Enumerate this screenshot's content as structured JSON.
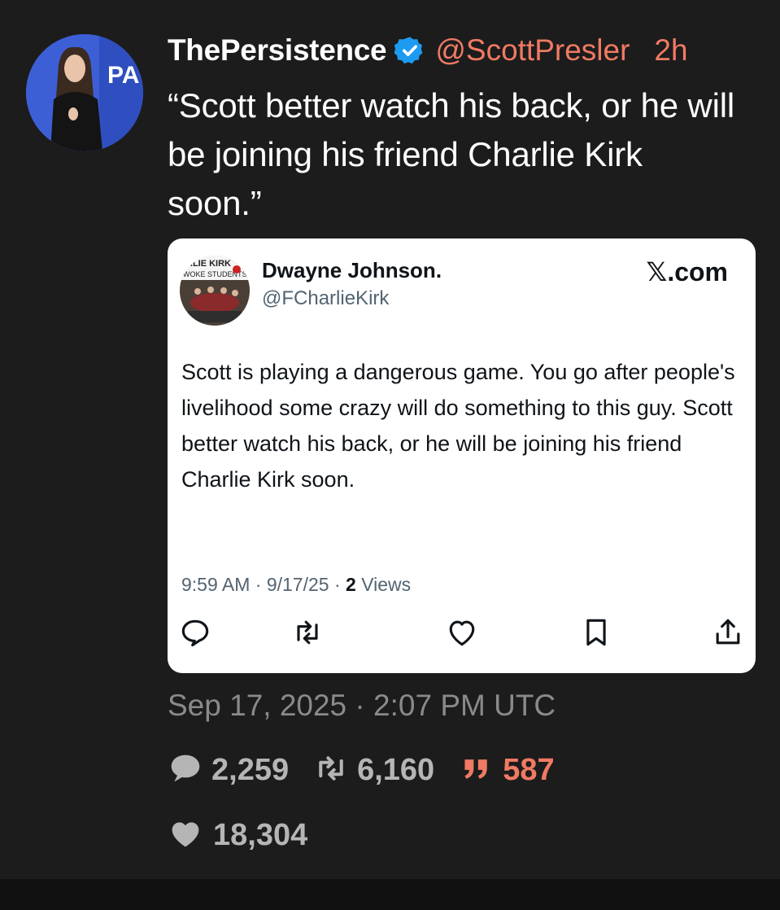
{
  "author": {
    "display_name": "ThePersistence",
    "handle": "@ScottPresler",
    "time_ago": "2h"
  },
  "tweet_text": "“Scott better watch his back, or he will be joining his friend Charlie Kirk soon.”",
  "quoted_post": {
    "display_name": "Dwayne Johnson.",
    "handle": "@FCharlieKirk",
    "source": "𝕏.com",
    "text": "Scott is playing a dangerous game. You go after people's livelihood some crazy will do something to this guy. Scott better watch his back, or he will be joining his friend Charlie Kirk soon.",
    "meta_time": "9:59 AM · 9/17/25 · ",
    "views_count": "2",
    "views_label": " Views"
  },
  "timestamp": "Sep 17, 2025 · 2:07 PM UTC",
  "stats": {
    "replies": "2,259",
    "reposts": "6,160",
    "quotes": "587",
    "likes": "18,304"
  },
  "colors": {
    "background": "#1c1c1c",
    "accent": "#f07a63",
    "verified": "#1d9bf0",
    "muted": "#8a8a8a"
  }
}
